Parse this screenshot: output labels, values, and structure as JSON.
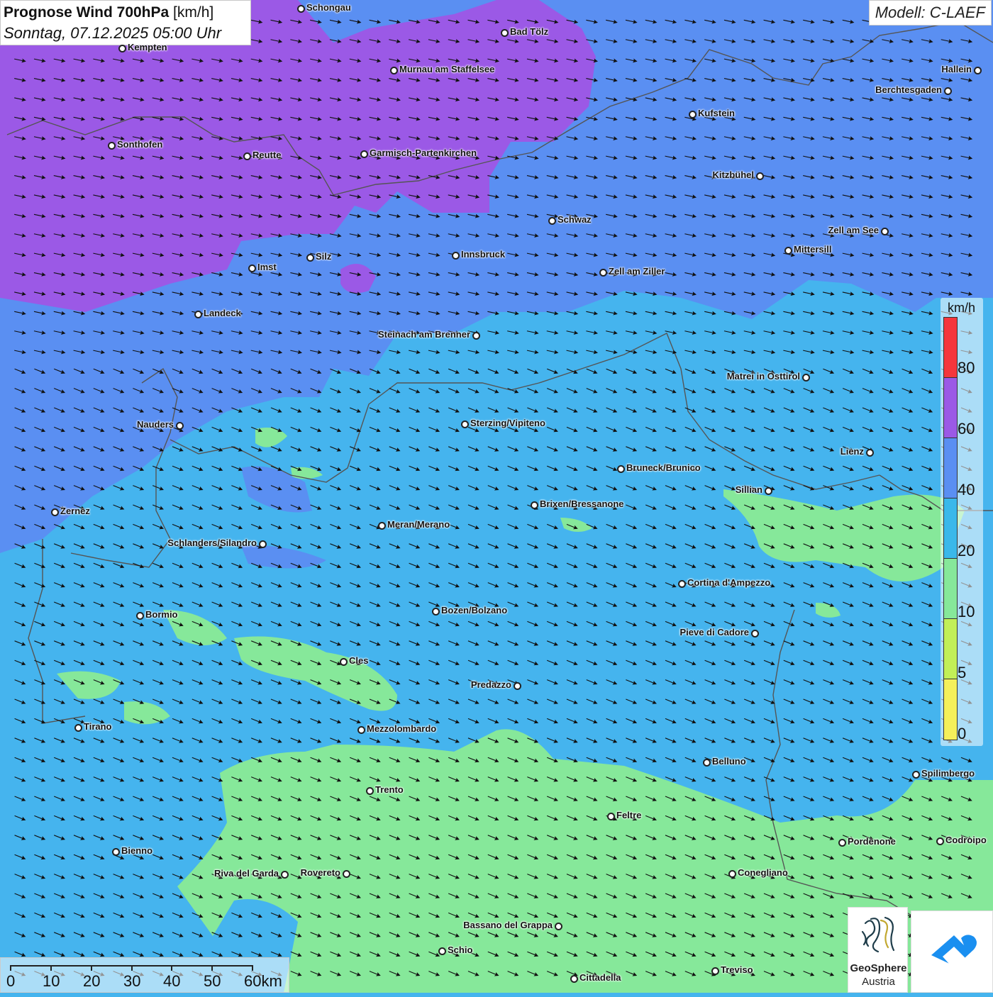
{
  "header": {
    "title_bold": "Prognose Wind 700hPa",
    "title_unit": "[km/h]",
    "subtitle": "Sonntag, 07.12.2025 05:00 Uhr"
  },
  "model_label": "Modell: C-LAEF",
  "legend": {
    "unit": "km/h",
    "ticks": [
      "80",
      "60",
      "40",
      "20",
      "10",
      "5",
      "0"
    ],
    "colors": [
      "#f5363c",
      "#9b59e6",
      "#5a8ff2",
      "#3ab8ea",
      "#86e89a",
      "#c2ef57",
      "#f5f05a"
    ]
  },
  "scale": {
    "labels": [
      "0",
      "10",
      "20",
      "30",
      "40",
      "50",
      "60km"
    ]
  },
  "colors": {
    "wind_10_20": "#86e89a",
    "wind_20_40": "#45b4ee",
    "wind_40_60": "#5a8ff2",
    "wind_60_80": "#9b59e6",
    "arrow": "#111111",
    "border": "#555555"
  },
  "wind": {
    "direction": "west-northwest to east-southeast",
    "arrow_icon": "wind-arrow-icon"
  },
  "cities": [
    {
      "name": "Schongau"
    },
    {
      "name": "Bad Tölz"
    },
    {
      "name": "Kempten"
    },
    {
      "name": "Murnau am Staffelsee"
    },
    {
      "name": "Hallein"
    },
    {
      "name": "Berchtesgaden"
    },
    {
      "name": "Kufstein"
    },
    {
      "name": "Sonthofen"
    },
    {
      "name": "Reutte"
    },
    {
      "name": "Garmisch-Partenkirchen"
    },
    {
      "name": "Kitzbühel"
    },
    {
      "name": "Schwaz"
    },
    {
      "name": "Zell am See"
    },
    {
      "name": "Mittersill"
    },
    {
      "name": "Innsbruck"
    },
    {
      "name": "Silz"
    },
    {
      "name": "Imst"
    },
    {
      "name": "Zell am Ziller"
    },
    {
      "name": "Landeck"
    },
    {
      "name": "Steinach am Brenner"
    },
    {
      "name": "Matrei in Osttirol"
    },
    {
      "name": "Nauders"
    },
    {
      "name": "Sterzing/Vipiteno"
    },
    {
      "name": "Lienz"
    },
    {
      "name": "Bruneck/Brunico"
    },
    {
      "name": "Sillian"
    },
    {
      "name": "Brixen/Bressanone"
    },
    {
      "name": "Zernez"
    },
    {
      "name": "Meran/Merano"
    },
    {
      "name": "Schlanders/Silandro"
    },
    {
      "name": "Cortina d'Ampezzo"
    },
    {
      "name": "Bozen/Bolzano"
    },
    {
      "name": "Bormio"
    },
    {
      "name": "Pieve di Cadore"
    },
    {
      "name": "Cles"
    },
    {
      "name": "Predazzo"
    },
    {
      "name": "Tirano"
    },
    {
      "name": "Mezzolombardo"
    },
    {
      "name": "Belluno"
    },
    {
      "name": "Spilimbergo"
    },
    {
      "name": "Trento"
    },
    {
      "name": "Feltre"
    },
    {
      "name": "Pordenone"
    },
    {
      "name": "Codroipo"
    },
    {
      "name": "Bienno"
    },
    {
      "name": "Riva del Garda"
    },
    {
      "name": "Rovereto"
    },
    {
      "name": "Conegliano"
    },
    {
      "name": "Bassano del Grappa"
    },
    {
      "name": "Schio"
    },
    {
      "name": "Treviso"
    },
    {
      "name": "Cittadella"
    }
  ],
  "logos": {
    "geosphere_name": "GeoSphere",
    "geosphere_sub": "Austria"
  }
}
